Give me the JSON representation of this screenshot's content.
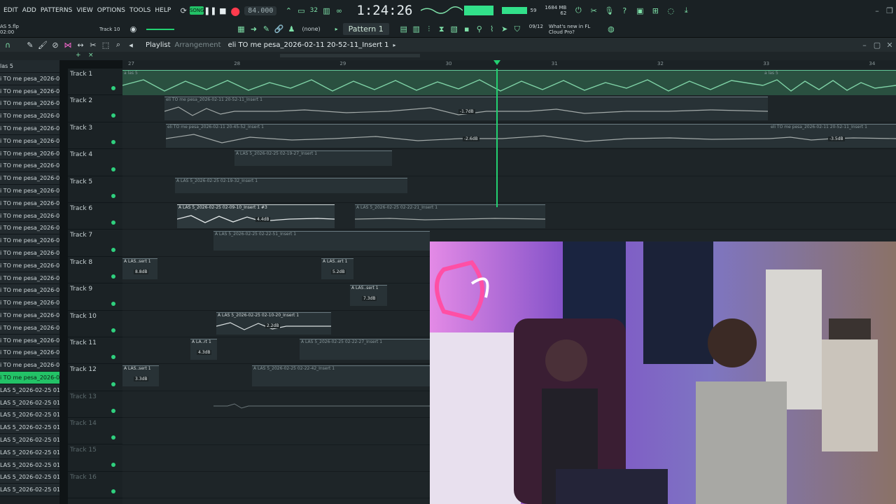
{
  "menu": [
    "EDIT",
    "ADD",
    "PATTERNS",
    "VIEW",
    "OPTIONS",
    "TOOLS",
    "HELP"
  ],
  "tempo": "84.000",
  "clock": "1:24:26",
  "cpu": {
    "ram_label": "1684 MB",
    "voices": "62",
    "cpu": "59"
  },
  "song_name": "AS 5.flp",
  "song_time": "02:00",
  "track_hint": "Track 10",
  "pattern_none": "(none)",
  "pattern": "Pattern 1",
  "news": {
    "date": "09/12",
    "text": "What's new in FL Cloud Pro?"
  },
  "playlist": {
    "title": "Playlist",
    "subtitle": "Arrangement",
    "clip_name": "eli TO me pesa_2026-02-11 20-52-11_Insert 1"
  },
  "ruler_marks": [
    "27",
    "28",
    "29",
    "30",
    "31",
    "32",
    "33",
    "34"
  ],
  "patterns": [
    {
      "label": "las 5",
      "selected": false
    },
    {
      "label": "i TO me pesa_2026-02-...",
      "selected": false
    },
    {
      "label": "i TO me pesa_2026-02-...",
      "selected": false
    },
    {
      "label": "i TO me pesa_2026-02-...",
      "selected": false
    },
    {
      "label": "i TO me pesa_2026-02-...",
      "selected": false
    },
    {
      "label": "i TO me pesa_2026-02-...",
      "selected": false
    },
    {
      "label": "i TO me pesa_2026-02-...",
      "selected": false
    },
    {
      "label": "i TO me pesa_2026-02-...",
      "selected": false
    },
    {
      "label": "i TO me pesa_2026-02-...",
      "selected": false
    },
    {
      "label": "i TO me pesa_2026-02-...",
      "selected": false
    },
    {
      "label": "i TO me pesa_2026-02-...",
      "selected": false
    },
    {
      "label": "i TO me pesa_2026-02-...",
      "selected": false
    },
    {
      "label": "i TO me pesa_2026-02-...",
      "selected": false
    },
    {
      "label": "i TO me pesa_2026-02-...",
      "selected": false
    },
    {
      "label": "i TO me pesa_2026-02-...",
      "selected": false
    },
    {
      "label": "i TO me pesa_2026-02-...",
      "selected": false
    },
    {
      "label": "i TO me pesa_2026-02-...",
      "selected": false
    },
    {
      "label": "i TO me pesa_2026-02-...",
      "selected": false
    },
    {
      "label": "i TO me pesa_2026-02-...",
      "selected": false
    },
    {
      "label": "i TO me pesa_2026-02-...",
      "selected": false
    },
    {
      "label": "i TO me pesa_2026-02-...",
      "selected": false
    },
    {
      "label": "i TO me pesa_2026-02-...",
      "selected": false
    },
    {
      "label": "i TO me pesa_2026-02-...",
      "selected": false
    },
    {
      "label": "i TO me pesa_2026-02-...",
      "selected": false
    },
    {
      "label": "i TO me pesa_2026-02-...",
      "selected": false
    },
    {
      "label": "i TO me pesa_2026-02-...",
      "selected": true
    },
    {
      "label": "LAS 5_2026-02-25 01-...",
      "selected": false
    },
    {
      "label": "LAS 5_2026-02-25 01-...",
      "selected": false
    },
    {
      "label": "LAS 5_2026-02-25 01-...",
      "selected": false
    },
    {
      "label": "LAS 5_2026-02-25 01-...",
      "selected": false
    },
    {
      "label": "LAS 5_2026-02-25 01-...",
      "selected": false
    },
    {
      "label": "LAS 5_2026-02-25 01-...",
      "selected": false
    },
    {
      "label": "LAS 5_2026-02-25 01-...",
      "selected": false
    },
    {
      "label": "LAS 5_2026-02-25 01-...",
      "selected": false
    },
    {
      "label": "LAS 5_2026-02-25 01-...",
      "selected": false
    }
  ],
  "tracks": [
    {
      "label": "Track 1",
      "dim": false
    },
    {
      "label": "Track 2",
      "dim": false
    },
    {
      "label": "Track 3",
      "dim": false
    },
    {
      "label": "Track 4",
      "dim": false
    },
    {
      "label": "Track 5",
      "dim": false
    },
    {
      "label": "Track 6",
      "dim": false
    },
    {
      "label": "Track 7",
      "dim": false
    },
    {
      "label": "Track 8",
      "dim": false
    },
    {
      "label": "Track 9",
      "dim": false
    },
    {
      "label": "Track 10",
      "dim": false
    },
    {
      "label": "Track 11",
      "dim": false
    },
    {
      "label": "Track 12",
      "dim": false
    },
    {
      "label": "Track 13",
      "dim": true
    },
    {
      "label": "Track 14",
      "dim": true
    },
    {
      "label": "Track 15",
      "dim": true
    },
    {
      "label": "Track 16",
      "dim": true
    }
  ],
  "clips": {
    "t1a": "a las 5",
    "t1b": "a las 5",
    "t2": "eli TO me pesa_2026-02-11 20-52-11_Insert 1",
    "t2db": "-1.7dB",
    "t3a": "eli TO me pesa_2026-02-11 20-45-52_Insert 1",
    "t3db": "-2.6dB",
    "t3b": "eli TO me pesa_2026-02-11 20-52-11_Insert 1",
    "t3bdb": "-3.5dB",
    "t4": "A LAS 5_2026-02-25 02-19-27_Insert 1",
    "t5": "A LAS 5_2026-02-25 02-19-32_Insert 1",
    "t6a": "A LAS 5_2026-02-25 02-09-10_Insert 1 #3",
    "t6adb": "4.4dB",
    "t6b": "A LAS 5_2026-02-25 02-22-21_Insert 1",
    "t7": "A LAS 5_2026-02-25 02-22-51_Insert 1",
    "t8a": "A LAS..sert 1",
    "t8adb": "8.8dB",
    "t8b": "A LAS..ert 1",
    "t8bdb": "5.2dB",
    "t9": "A LAS..sert 1",
    "t9db": "7.3dB",
    "t10": "A LAS 5_2026-02-25 02-10-20_Insert 1",
    "t10db": "2.2dB",
    "t11a": "A LA..rt 1",
    "t11adb": "4.3dB",
    "t11b": "A LAS 5_2026-02-25 02-22-27_Insert 1",
    "t12a": "A LAS..sert 1",
    "t12adb": "3.3dB",
    "t12b": "A LAS 5_2026-02-25 02-22-42_Insert 1"
  },
  "colors": {
    "accent": "#23d071",
    "wave": "#7fd2a6",
    "bg": "#1e2528"
  }
}
